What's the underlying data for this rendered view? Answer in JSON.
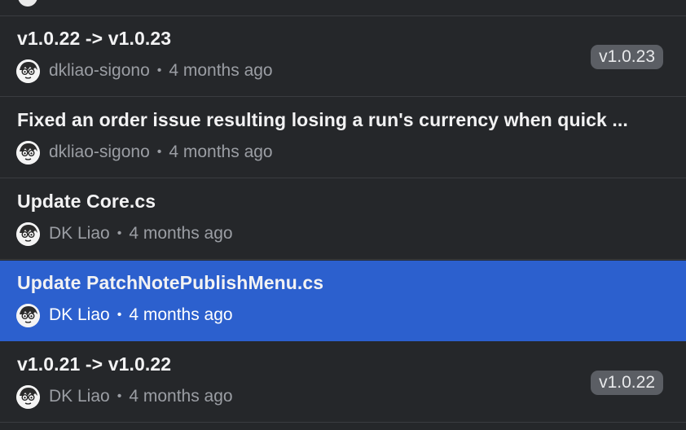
{
  "rows": [
    {
      "title": "v1.0.22 -> v1.0.23",
      "author": "dkliao-sigono",
      "time": "4 months ago",
      "tag": "v1.0.23",
      "selected": false
    },
    {
      "title": "Fixed an order issue resulting losing a run's currency when quick ...",
      "author": "dkliao-sigono",
      "time": "4 months ago",
      "tag": "",
      "selected": false
    },
    {
      "title": "Update Core.cs",
      "author": "DK Liao",
      "time": "4 months ago",
      "tag": "",
      "selected": false
    },
    {
      "title": "Update PatchNotePublishMenu.cs",
      "author": "DK Liao",
      "time": "4 months ago",
      "tag": "",
      "selected": true
    },
    {
      "title": "v1.0.21 -> v1.0.22",
      "author": "DK Liao",
      "time": "4 months ago",
      "tag": "v1.0.22",
      "selected": false
    }
  ],
  "separator": "•",
  "colors": {
    "background": "#25272a",
    "selected": "#2c60ce",
    "tag_background": "#5b5e64",
    "muted_text": "#9b9ea4",
    "title_text": "#f2f2f3"
  }
}
